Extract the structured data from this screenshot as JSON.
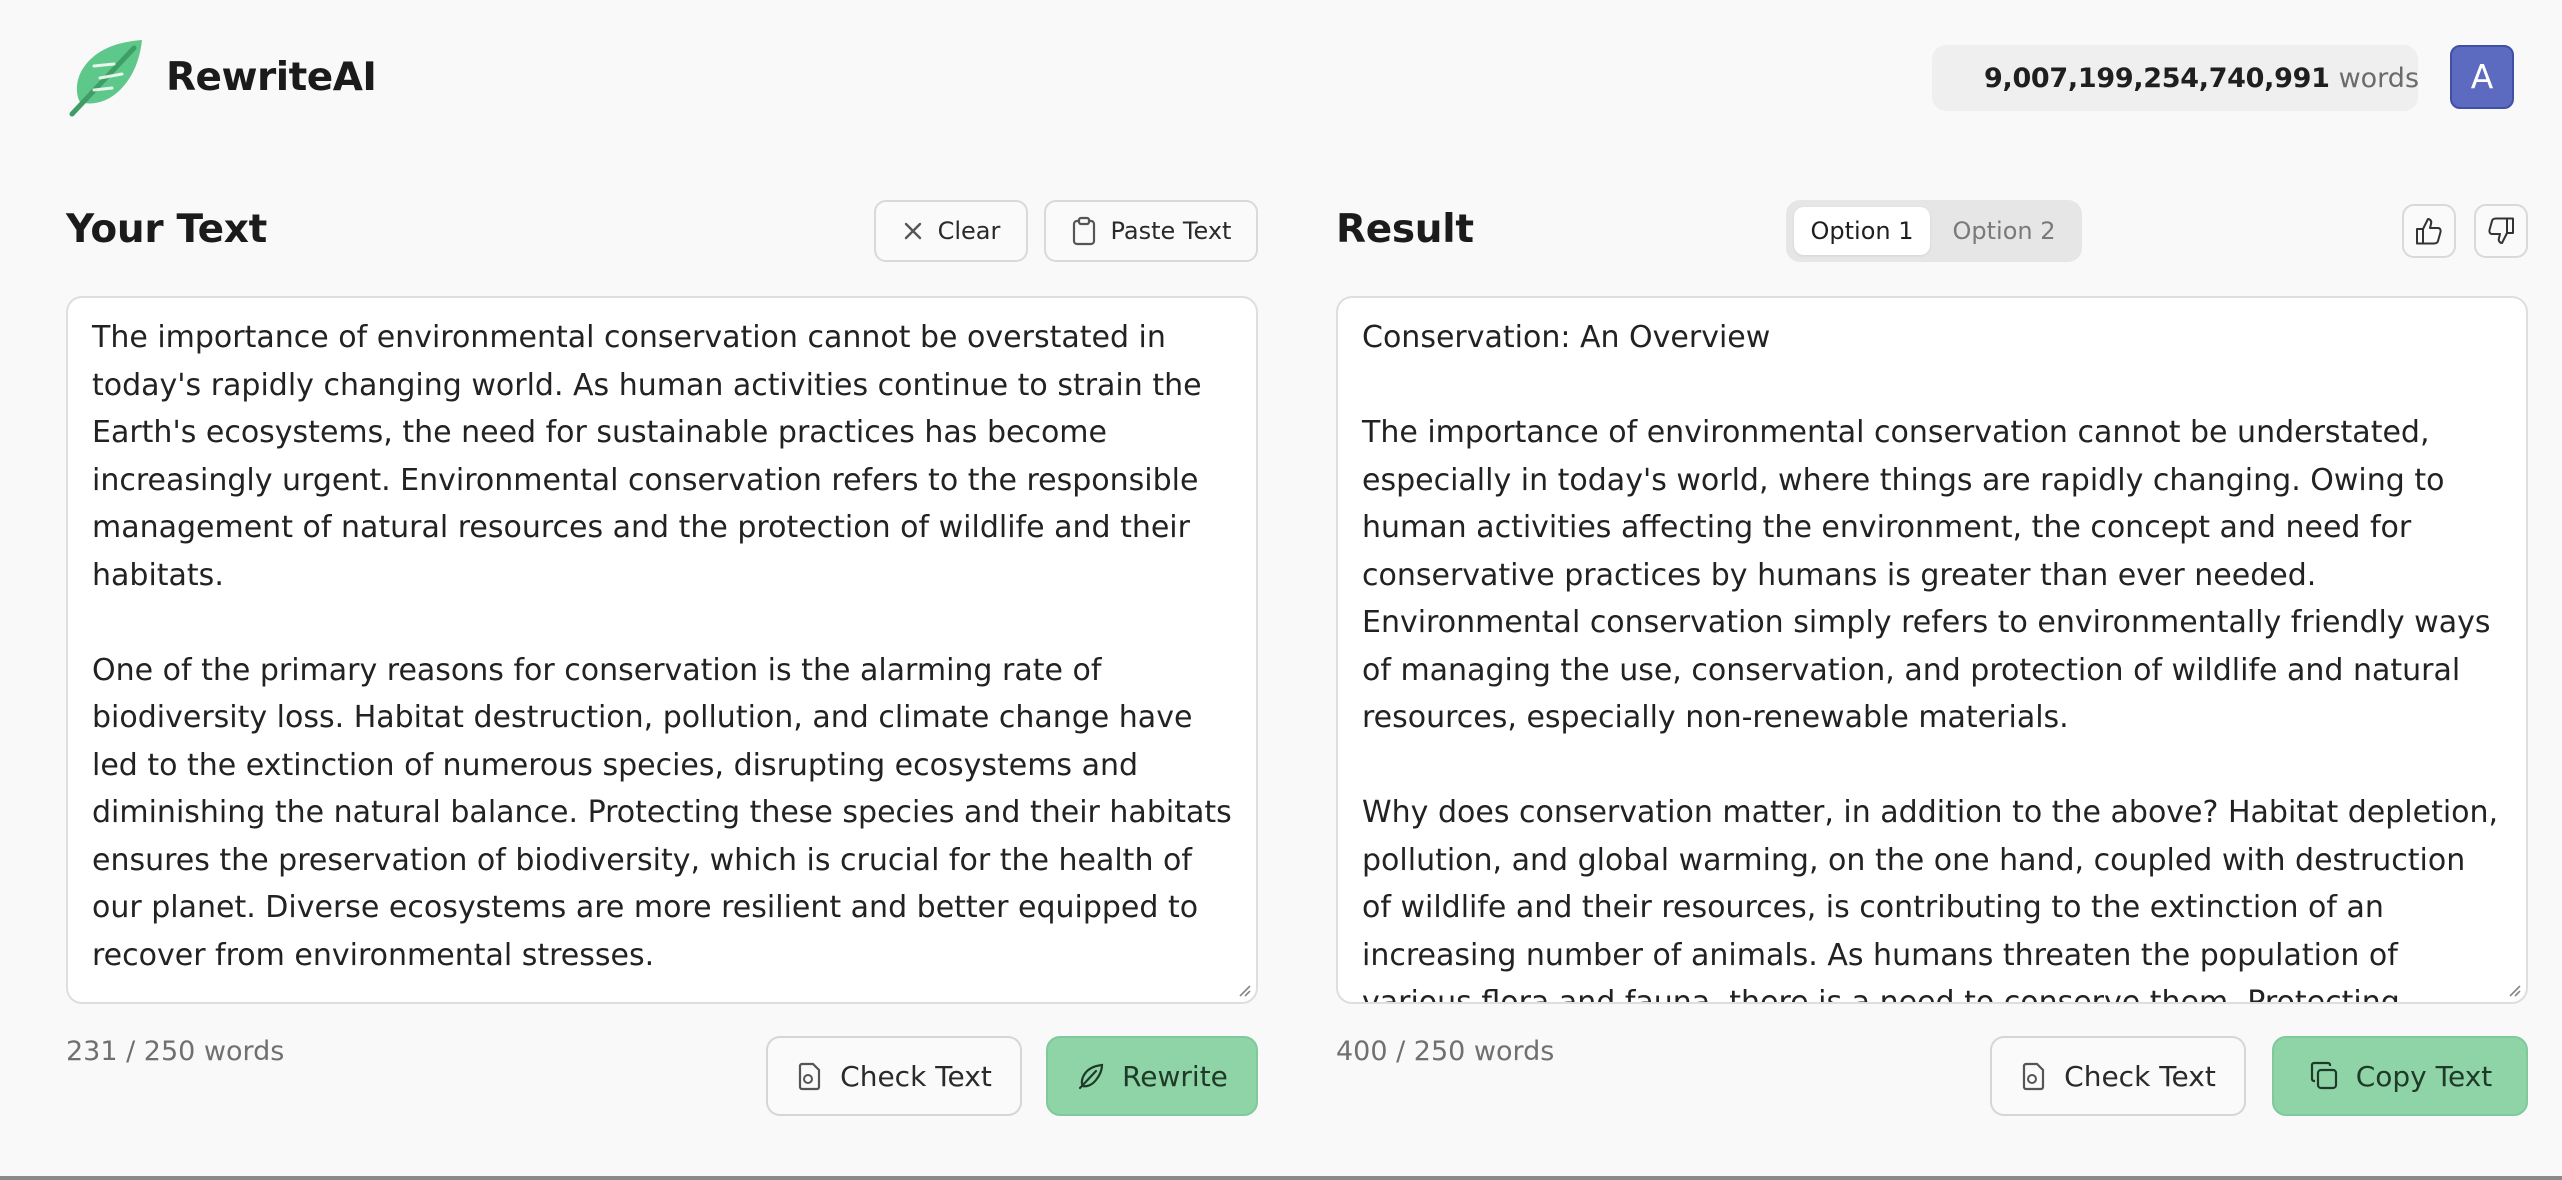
{
  "app": {
    "name": "RewriteAI",
    "word_balance": "9,007,199,254,740,991",
    "word_balance_unit": "words",
    "avatar_initial": "A",
    "accent_color": "#8fd4a7",
    "avatar_color": "#5c6bc0"
  },
  "input_panel": {
    "title": "Your Text",
    "clear_label": "Clear",
    "paste_label": "Paste Text",
    "paragraphs": [
      "The importance of environmental conservation cannot be overstated in today's rapidly changing world. As human activities continue to strain the Earth's ecosystems, the need for sustainable practices has become increasingly urgent. Environmental conservation refers to the responsible management of natural resources and the protection of wildlife and their habitats.",
      "One of the primary reasons for conservation is the alarming rate of biodiversity loss. Habitat destruction, pollution, and climate change have led to the extinction of numerous species, disrupting ecosystems and diminishing the natural balance. Protecting these species and their habitats ensures the preservation of biodiversity, which is crucial for the health of our planet. Diverse ecosystems are more resilient and better equipped to recover from environmental stresses."
    ],
    "word_count": "231 / 250 words",
    "check_label": "Check Text",
    "rewrite_label": "Rewrite"
  },
  "result_panel": {
    "title": "Result",
    "option_1": "Option 1",
    "option_2": "Option 2",
    "selected_option": "Option 1",
    "paragraphs": [
      "Conservation: An Overview",
      "The importance of environmental conservation cannot be understated, especially in today's world, where things are rapidly changing. Owing to human activities affecting the environment, the concept and need for conservative practices by humans is greater than ever needed. Environmental conservation simply refers to environmentally friendly ways of managing the use, conservation, and protection of wildlife and natural resources, especially non-renewable materials.",
      "Why does conservation matter, in addition to the above? Habitat depletion, pollution, and global warming, on the one hand, coupled with destruction of wildlife and their resources, is contributing to the extinction of an increasing number of animals. As humans threaten the population of various flora and fauna, there is a need to conserve them. Protecting wildlife and"
    ],
    "word_count": "400 / 250 words",
    "check_label": "Check Text",
    "copy_label": "Copy Text"
  }
}
